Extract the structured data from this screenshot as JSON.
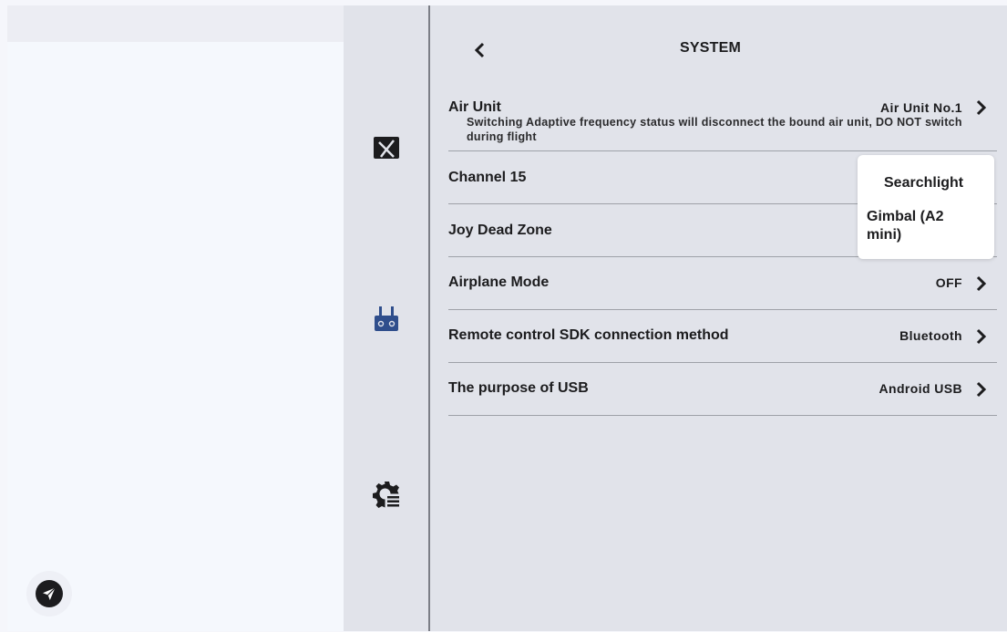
{
  "colors": {
    "rail_icon": "#1c1c1e",
    "accent_rc": "#2f4e8c"
  },
  "left_panel": {
    "logo_icon": "paper-plane-icon"
  },
  "rail": {
    "items": [
      {
        "icon": "airplane-video-icon"
      },
      {
        "icon": "remote-controller-icon"
      },
      {
        "icon": "gear-list-icon"
      }
    ]
  },
  "header": {
    "title": "SYSTEM",
    "back_icon": "chevron-left-icon"
  },
  "settings": {
    "air_unit": {
      "label": "Air Unit",
      "value": "Air Unit No.1",
      "description": "Switching Adaptive frequency status will disconnect the bound air unit, DO NOT switch during flight"
    },
    "channel": {
      "label": "Channel 15"
    },
    "joy_dead_zone": {
      "label": "Joy Dead Zone"
    },
    "airplane_mode": {
      "label": "Airplane Mode",
      "value": "OFF"
    },
    "sdk_connection": {
      "label": "Remote control SDK connection method",
      "value": "Bluetooth"
    },
    "usb_purpose": {
      "label": "The purpose of USB",
      "value": "Android USB"
    }
  },
  "dropdown": {
    "options": [
      "Searchlight",
      "Gimbal (A2 mini)"
    ]
  }
}
